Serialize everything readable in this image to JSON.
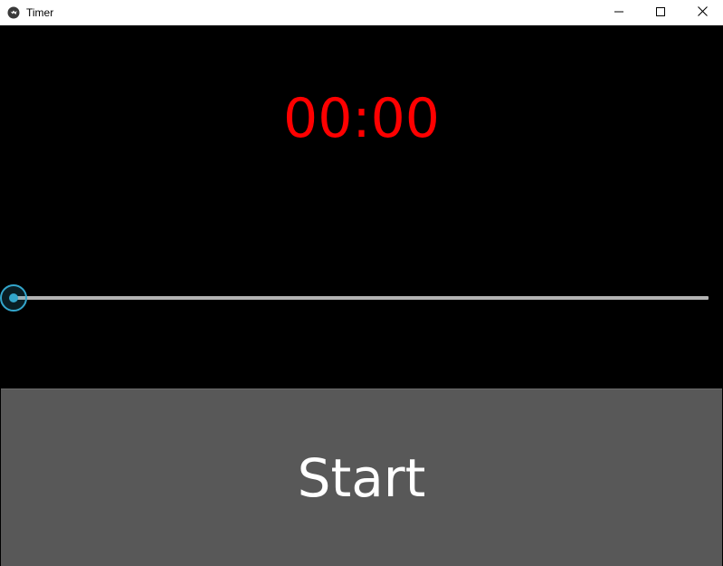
{
  "window": {
    "title": "Timer",
    "app_icon": "kivy-icon",
    "controls": {
      "minimize_icon": "minimize-icon",
      "maximize_icon": "maximize-icon",
      "close_icon": "close-icon"
    }
  },
  "timer": {
    "display": "00:00",
    "display_color": "#ff0000"
  },
  "slider": {
    "value_fraction": 0.0,
    "accent_color": "#33a6cc",
    "track_color": "#b3b3b3"
  },
  "button": {
    "label": "Start",
    "background": "#585858"
  },
  "colors": {
    "background": "#000000"
  }
}
